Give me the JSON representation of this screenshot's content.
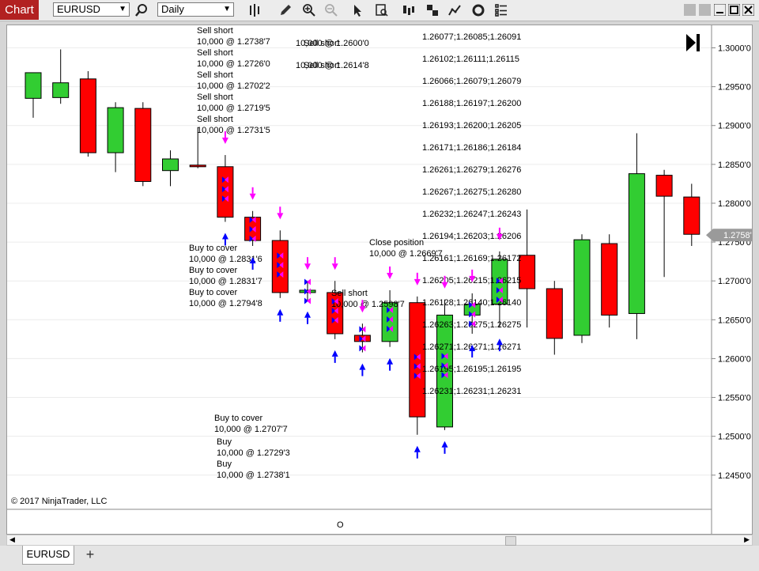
{
  "toolbar": {
    "chart_label": "Chart",
    "instrument": "EURUSD",
    "period": "Daily",
    "icons": [
      "search-icon",
      "bar-type-icon",
      "pencil-icon",
      "zoom-in-icon",
      "zoom-out-icon",
      "pointer-icon",
      "data-box-icon",
      "properties-icon",
      "strategies-icon",
      "indicators-icon",
      "refresh-icon",
      "list-icon"
    ]
  },
  "copyright": "© 2017 NinjaTrader, LLC",
  "tabs": {
    "active": "EURUSD",
    "add": "+"
  },
  "colors": {
    "up": "#32cd32",
    "down": "#ff0000",
    "sell_arrow": "#ff00ff",
    "buy_arrow": "#0000ff"
  },
  "chart_data": {
    "type": "candlestick",
    "instrument": "EURUSD",
    "y_ticks": [
      "1.3000'0",
      "1.2950'0",
      "1.2900'0",
      "1.2850'0",
      "1.2800'0",
      "1.2750'0",
      "1.2700'0",
      "1.2650'0",
      "1.2600'0",
      "1.2550'0",
      "1.2500'0",
      "1.2450'0"
    ],
    "ylim": [
      1.2406,
      1.3029
    ],
    "last_price": "1.2758'9",
    "last_price_value": 1.2759,
    "x_tick": "O",
    "candles": [
      {
        "o": 1.2935,
        "h": 1.2957,
        "l": 1.291,
        "c": 1.2968
      },
      {
        "o": 1.2936,
        "h": 1.2998,
        "l": 1.2928,
        "c": 1.2955
      },
      {
        "o": 1.296,
        "h": 1.297,
        "l": 1.286,
        "c": 1.2865
      },
      {
        "o": 1.2865,
        "h": 1.293,
        "l": 1.284,
        "c": 1.2923
      },
      {
        "o": 1.2922,
        "h": 1.293,
        "l": 1.2822,
        "c": 1.2828
      },
      {
        "o": 1.2842,
        "h": 1.2868,
        "l": 1.2822,
        "c": 1.2857
      },
      {
        "o": 1.2849,
        "h": 1.2898,
        "l": 1.2845,
        "c": 1.2847
      },
      {
        "o": 1.2847,
        "h": 1.2862,
        "l": 1.2776,
        "c": 1.2782
      },
      {
        "o": 1.2782,
        "h": 1.279,
        "l": 1.2745,
        "c": 1.2752
      },
      {
        "o": 1.2752,
        "h": 1.2765,
        "l": 1.2678,
        "c": 1.2685
      },
      {
        "o": 1.2685,
        "h": 1.27,
        "l": 1.2675,
        "c": 1.2688
      },
      {
        "o": 1.2685,
        "h": 1.27,
        "l": 1.2625,
        "c": 1.2632
      },
      {
        "o": 1.263,
        "h": 1.2645,
        "l": 1.2608,
        "c": 1.2622
      },
      {
        "o": 1.2622,
        "h": 1.2688,
        "l": 1.2615,
        "c": 1.2672
      },
      {
        "o": 1.2672,
        "h": 1.268,
        "l": 1.2502,
        "c": 1.2525
      },
      {
        "o": 1.2512,
        "h": 1.2676,
        "l": 1.2508,
        "c": 1.2656
      },
      {
        "o": 1.2656,
        "h": 1.2684,
        "l": 1.2632,
        "c": 1.267
      },
      {
        "o": 1.267,
        "h": 1.2738,
        "l": 1.264,
        "c": 1.2728
      },
      {
        "o": 1.2733,
        "h": 1.2792,
        "l": 1.264,
        "c": 1.269
      },
      {
        "o": 1.269,
        "h": 1.27,
        "l": 1.2605,
        "c": 1.2626
      },
      {
        "o": 1.263,
        "h": 1.276,
        "l": 1.262,
        "c": 1.2753
      },
      {
        "o": 1.2748,
        "h": 1.276,
        "l": 1.264,
        "c": 1.2656
      },
      {
        "o": 1.2658,
        "h": 1.289,
        "l": 1.2625,
        "c": 1.2838
      },
      {
        "o": 1.2836,
        "h": 1.2843,
        "l": 1.2705,
        "c": 1.2809
      },
      {
        "o": 1.2808,
        "h": 1.2825,
        "l": 1.2745,
        "c": 1.276
      }
    ],
    "annotations": [
      {
        "text": "Sell short",
        "col": 270
      },
      {
        "text": "10,000 @ 1.2738'7",
        "col": 270
      },
      {
        "text": "Sell short",
        "col": 270
      },
      {
        "text": "10,000 @ 1.2726'0",
        "col": 270
      },
      {
        "text": "Sell short",
        "col": 270
      },
      {
        "text": "10,000 @ 1.2702'2",
        "col": 270
      },
      {
        "text": "Sell short",
        "col": 270
      },
      {
        "text": "10,000 @ 1.2719'5",
        "col": 270
      },
      {
        "text": "Sell short",
        "col": 270
      },
      {
        "text": "10,000 @ 1.2731'5",
        "col": 270
      },
      {
        "text": "Buy to cover",
        "col": 260
      },
      {
        "text": "10,000 @ 1.2831'6",
        "col": 260
      },
      {
        "text": "Buy to cover",
        "col": 260
      },
      {
        "text": "10,000 @ 1.2831'7",
        "col": 260
      },
      {
        "text": "Buy to cover",
        "col": 260
      },
      {
        "text": "10,000 @ 1.2794'8",
        "col": 260
      },
      {
        "text": "Buy to cover",
        "col": 292
      },
      {
        "text": "10,000 @ 1.2707'7",
        "col": 292
      },
      {
        "text": "Buy",
        "col": 295
      },
      {
        "text": "10,000 @ 1.2729'3",
        "col": 295
      },
      {
        "text": "Buy",
        "col": 295
      },
      {
        "text": "10,000 @ 1.2738'1",
        "col": 295
      },
      {
        "text": "Sell short",
        "col": 405
      },
      {
        "text": "10,000 @ 1.2600'0",
        "col": 395
      },
      {
        "text": "Sell short",
        "col": 405
      },
      {
        "text": "10,000 @ 1.2614'8",
        "col": 395
      },
      {
        "text": "Sell short",
        "col": 440
      },
      {
        "text": "10,000 @ 1.2598'7",
        "col": 440
      },
      {
        "text": "Close position",
        "col": 488
      },
      {
        "text": "10,000 @ 1.2669'7",
        "col": 488
      },
      {
        "text": "1.26077;1.26085;1.26091",
        "col": 555
      },
      {
        "text": "1.26102;1.26111;1.26115",
        "col": 555
      },
      {
        "text": "1.26066;1.26079;1.26079",
        "col": 555
      },
      {
        "text": "1.26188;1.26197;1.26200",
        "col": 555
      },
      {
        "text": "1.26193;1.26200;1.26205",
        "col": 555
      },
      {
        "text": "1.26171;1.26186;1.26184",
        "col": 555
      },
      {
        "text": "1.26261;1.26279;1.26276",
        "col": 555
      },
      {
        "text": "1.26267;1.26275;1.26280",
        "col": 555
      },
      {
        "text": "1.26232;1.26247;1.26243",
        "col": 555
      },
      {
        "text": "1.26194;1.26203;1.26206",
        "col": 555
      },
      {
        "text": "1.26161;1.26169;1.26172",
        "col": 555
      },
      {
        "text": "1.26205;1.26215;1.26215",
        "col": 555
      },
      {
        "text": "1.26128;1.26140;1.26140",
        "col": 555
      },
      {
        "text": "1.26263;1.26275;1.26275",
        "col": 555
      },
      {
        "text": "1.26271;1.26271;1.26271",
        "col": 555
      },
      {
        "text": "1.26195;1.26195;1.26195",
        "col": 555
      },
      {
        "text": "1.26231;1.26231;1.26231",
        "col": 555
      }
    ]
  }
}
